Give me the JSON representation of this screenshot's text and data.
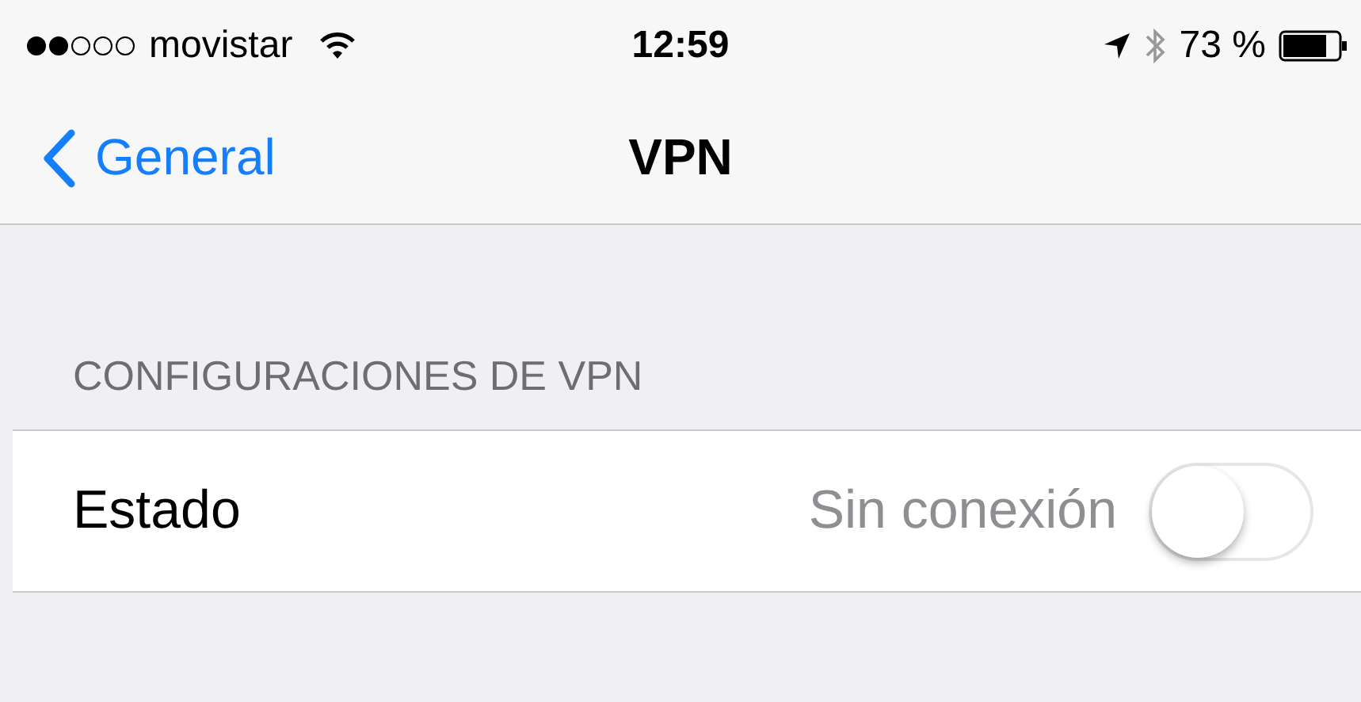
{
  "status_bar": {
    "carrier": "movistar",
    "time": "12:59",
    "battery": "73 %"
  },
  "nav": {
    "back": "General",
    "title": "VPN"
  },
  "section": {
    "header": "CONFIGURACIONES DE VPN",
    "rows": [
      {
        "label": "Estado",
        "value": "Sin conexión",
        "on": false
      }
    ]
  }
}
